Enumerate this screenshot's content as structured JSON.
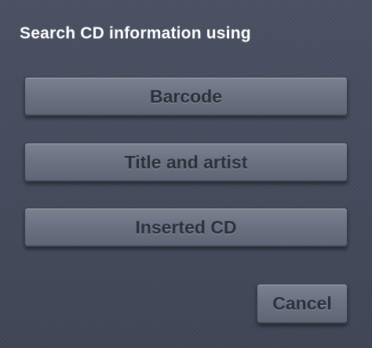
{
  "dialog": {
    "title": "Search CD information using",
    "buttons": {
      "barcode": "Barcode",
      "title_artist": "Title and artist",
      "inserted_cd": "Inserted CD",
      "cancel": "Cancel"
    }
  },
  "colors": {
    "background": "#454b5c",
    "button": "#6c7281",
    "button_text": "#2b2f3a",
    "title_text": "#ffffff"
  }
}
